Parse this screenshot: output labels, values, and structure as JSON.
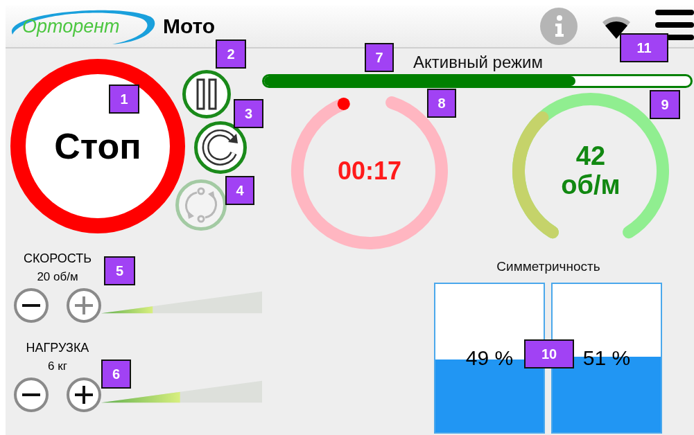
{
  "header": {
    "logo": "Орторент",
    "title": "Мото"
  },
  "stop_button": {
    "label": "Стоп"
  },
  "controls": [
    {
      "kind": "pause",
      "disabled": false
    },
    {
      "kind": "repeat",
      "disabled": false
    },
    {
      "kind": "cycle",
      "disabled": true
    }
  ],
  "mode": {
    "label": "Активный режим",
    "level": 0.73
  },
  "timer": {
    "time": "00:17"
  },
  "cadence": {
    "value": "42",
    "unit": "об/м"
  },
  "sliders": [
    {
      "label": "СКОРОСТЬ",
      "value": "20 об/м",
      "level": 0.32,
      "buttons": [
        {
          "kind": "minus",
          "disabled": false
        },
        {
          "kind": "plus",
          "disabled": true
        }
      ]
    },
    {
      "label": "НАГРУЗКА",
      "value": "6 кг",
      "level": 0.49,
      "buttons": [
        {
          "kind": "minus",
          "disabled": false
        },
        {
          "kind": "plus",
          "disabled": false
        }
      ]
    }
  ],
  "symmetry": {
    "title": "Симметричность",
    "sides": [
      {
        "reading": "49 %",
        "level": 0.49
      },
      {
        "reading": "51 %",
        "level": 0.51
      }
    ]
  },
  "callouts": [
    "1",
    "2",
    "3",
    "4",
    "5",
    "6",
    "7",
    "8",
    "9",
    "10",
    "11"
  ]
}
